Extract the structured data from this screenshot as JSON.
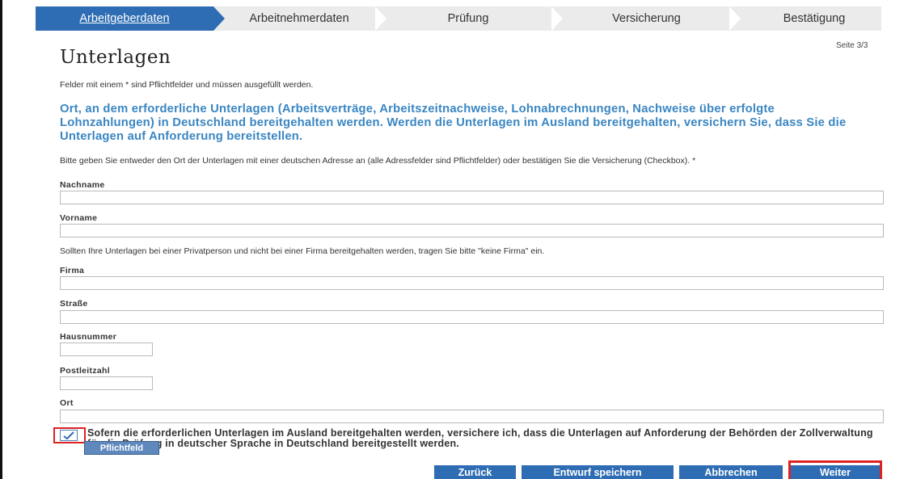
{
  "steps": {
    "items": [
      {
        "label": "Arbeitgeberdaten"
      },
      {
        "label": "Arbeitnehmerdaten"
      },
      {
        "label": "Prüfung"
      },
      {
        "label": "Versicherung"
      },
      {
        "label": "Bestätigung"
      }
    ],
    "active_index": 0
  },
  "page_indicator": "Seite 3/3",
  "title": "Unterlagen",
  "required_hint": "Felder mit einem * sind Pflichtfelder und müssen ausgefüllt werden.",
  "headline": "Ort, an dem erforderliche Unterlagen (Arbeitsverträge, Arbeitszeitnachweise, Lohnabrechnungen, Nachweise über erfolgte Lohnzahlungen) in Deutschland bereitgehalten werden. Werden die Unterlagen im Ausland bereitgehalten, versichern Sie, dass Sie die Unterlagen auf Anforderung bereitstellen.",
  "instruction": "Bitte geben Sie entweder den Ort der Unterlagen mit einer deutschen Adresse an (alle Adressfelder sind Pflichtfelder) oder bestätigen Sie die Versicherung (Checkbox). *",
  "fields": {
    "nachname": {
      "label": "Nachname",
      "value": ""
    },
    "vorname": {
      "label": "Vorname",
      "value": ""
    },
    "firma": {
      "label": "Firma",
      "value": ""
    },
    "strasse": {
      "label": "Straße",
      "value": ""
    },
    "hausnummer": {
      "label": "Hausnummer",
      "value": ""
    },
    "postleitzahl": {
      "label": "Postleitzahl",
      "value": ""
    },
    "ort": {
      "label": "Ort",
      "value": ""
    }
  },
  "private_note": "Sollten Ihre Unterlagen bei einer Privatperson und nicht bei einer Firma bereitgehalten werden, tragen Sie bitte \"keine Firma\" ein.",
  "assurance": {
    "checked": true,
    "text": "Sofern die erforderlichen Unterlagen im Ausland bereitgehalten werden, versichere ich, dass die Unterlagen auf Anforderung der Behörden der Zollverwaltung für die Prüfung in deutscher Sprache in Deutschland bereitgestellt werden.",
    "tooltip": "Pflichtfeld"
  },
  "buttons": {
    "back": "Zurück",
    "save_draft": "Entwurf speichern",
    "cancel": "Abbrechen",
    "next": "Weiter"
  },
  "colors": {
    "accent": "#2e6db3",
    "headline": "#3a86c2",
    "highlight": "#dd2222"
  }
}
